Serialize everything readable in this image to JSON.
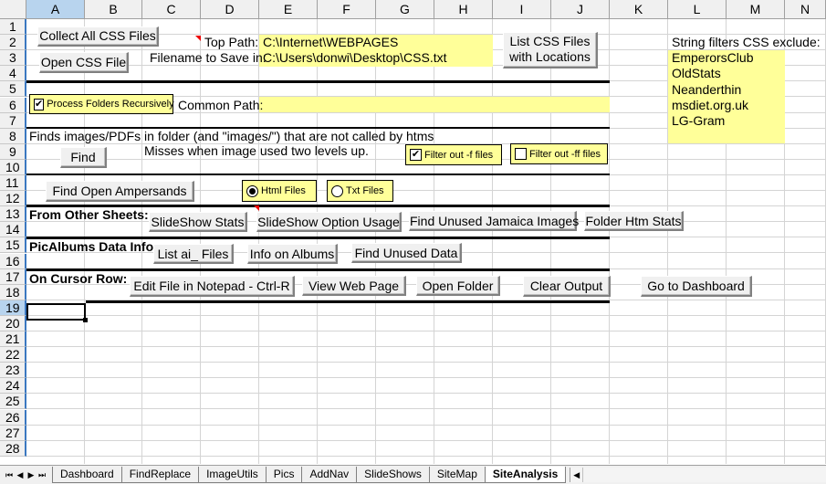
{
  "columns": [
    "A",
    "B",
    "C",
    "D",
    "E",
    "F",
    "G",
    "H",
    "I",
    "J",
    "K",
    "L",
    "M",
    "N"
  ],
  "rows": [
    "1",
    "2",
    "3",
    "4",
    "5",
    "6",
    "7",
    "8",
    "9",
    "10",
    "11",
    "12",
    "13",
    "14",
    "15",
    "16",
    "17",
    "18",
    "19",
    "20",
    "21",
    "22",
    "23",
    "24",
    "25",
    "26",
    "27",
    "28"
  ],
  "selected_cell": "A19",
  "colors": {
    "input_fill": "#ffff99",
    "comment_marker": "#e00000",
    "selection": "#b8d4ee"
  },
  "paths": {
    "top_path_label": "Top Path:",
    "top_path_value": "C:\\Internet\\WEBPAGES",
    "save_label": "Filename to Save in:",
    "save_value": "C:\\Users\\donwi\\Desktop\\CSS.txt",
    "common_path_label": "Common Path:",
    "common_path_value": ""
  },
  "buttons": {
    "collect_css": "Collect All CSS Files",
    "open_css": "Open CSS File",
    "list_css_line1": "List CSS Files",
    "list_css_line2": "with Locations",
    "find": "Find",
    "find_ampersands": "Find Open Ampersands",
    "slideshow_stats": "SlideShow Stats",
    "slideshow_option_usage": "SlideShow Option Usage",
    "find_unused_jamaica": "Find Unused Jamaica Images",
    "folder_htm_stats": "Folder Htm Stats",
    "list_ai_files": "List ai_ Files",
    "info_on_albums": "Info on Albums",
    "find_unused_data": "Find Unused Data",
    "edit_notepad": "Edit File in Notepad - Ctrl-R",
    "view_web_page": "View Web Page",
    "open_folder": "Open Folder",
    "clear_output": "Clear Output",
    "go_dashboard": "Go to Dashboard"
  },
  "controls": {
    "process_recursive": {
      "label": "Process Folders Recursively",
      "checked": true
    },
    "filter_f": {
      "label": "Filter out -f files",
      "checked": true
    },
    "filter_ff": {
      "label": "Filter out -ff files",
      "checked": false
    },
    "html_files": {
      "label": "Html Files",
      "selected": true
    },
    "txt_files": {
      "label": "Txt Files",
      "selected": false
    }
  },
  "text": {
    "finds_images": "Finds images/PDFs in folder (and \"images/\") that are not called by htms",
    "misses": "Misses when image used two levels up.",
    "from_other_sheets": "From Other Sheets:",
    "picalbums": "PicAlbums Data Info:",
    "on_cursor_row": "On Cursor Row:"
  },
  "filters": {
    "title": "String filters CSS exclude:",
    "items": [
      "EmperorsClub",
      "OldStats",
      "Neanderthin",
      "msdiet.org.uk",
      "LG-Gram"
    ]
  },
  "sheet_tabs": [
    "Dashboard",
    "FindReplace",
    "ImageUtils",
    "Pics",
    "AddNav",
    "SlideShows",
    "SiteMap",
    "SiteAnalysis"
  ],
  "active_tab": "SiteAnalysis",
  "nav_icons": {
    "first": "⏮",
    "prev": "◀",
    "next": "▶",
    "last": "⏭"
  }
}
